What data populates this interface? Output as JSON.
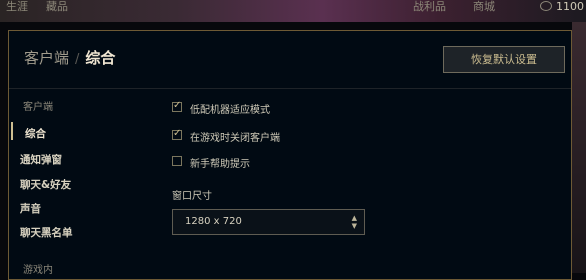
{
  "background": {
    "nav_left": [
      "生涯",
      "藏品"
    ],
    "nav_right": [
      "战利品",
      "商城"
    ],
    "currency_value": "1100"
  },
  "dialog": {
    "breadcrumb_parent": "客户端",
    "breadcrumb_separator": "/",
    "title": "综合",
    "restore_button": "恢复默认设置"
  },
  "sidebar": {
    "section_client": "客户端",
    "items": [
      "综合",
      "通知弹窗",
      "聊天&好友",
      "声音",
      "聊天黑名单"
    ],
    "active_index": 0,
    "section_ingame": "游戏内"
  },
  "settings": {
    "checkboxes": [
      {
        "label": "低配机器适应模式",
        "checked": true
      },
      {
        "label": "在游戏时关闭客户端",
        "checked": true
      },
      {
        "label": "新手帮助提示",
        "checked": false
      }
    ],
    "window_size_label": "窗口尺寸",
    "window_size_value": "1280 x 720"
  },
  "colors": {
    "accent_gold": "#cdbe91",
    "panel_bg": "#010a13",
    "border_gold": "#6e5a35"
  }
}
